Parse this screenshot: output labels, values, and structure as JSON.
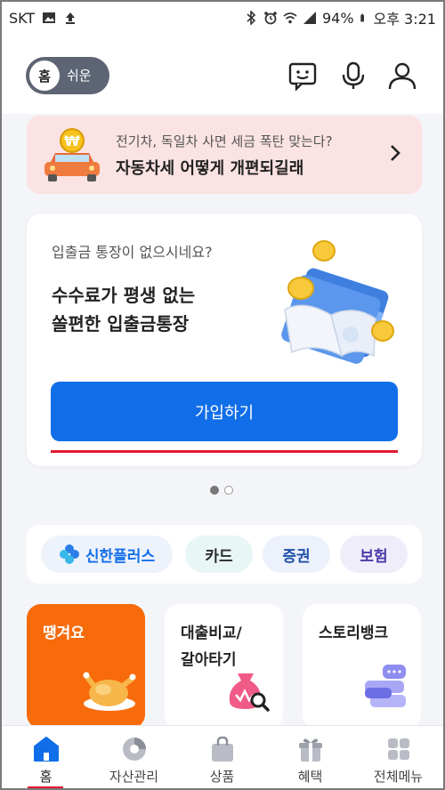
{
  "status_bar": {
    "carrier": "SKT",
    "battery": "94%",
    "time": "오후 3:21",
    "icons": [
      "photo-icon",
      "upload-icon",
      "bluetooth-icon",
      "alarm-icon",
      "wifi-icon",
      "signal-icon",
      "battery-icon"
    ]
  },
  "header": {
    "toggle_home": "홈",
    "toggle_easy": "쉬운",
    "icons": [
      "chatbot-icon",
      "microphone-icon",
      "profile-icon"
    ]
  },
  "banner": {
    "subtitle": "전기차, 독일차 사면 세금 폭탄 맞는다?",
    "title": "자동차세 어떻게 개편되길래",
    "icon": "car-with-coin-icon"
  },
  "promo_card": {
    "subtitle": "입출금 통장이 없으시네요?",
    "title_line1": "수수료가 평생 없는",
    "title_line2": "쏠편한 입출금통장",
    "button_label": "가입하기",
    "illustration": "bankbook-with-coins-icon"
  },
  "pagination": {
    "current": 1,
    "total": 2
  },
  "quick_links": [
    {
      "label": "신한플러스",
      "icon": "clover-icon",
      "bg": "#eef3fb",
      "color": "#116ee9"
    },
    {
      "label": "카드",
      "bg": "#e8f6f5",
      "color": "#2b2b2b"
    },
    {
      "label": "증권",
      "bg": "#ecf1fb",
      "color": "#1f4fa8"
    },
    {
      "label": "보험",
      "bg": "#efedf9",
      "color": "#4a3aa8"
    }
  ],
  "tiles": [
    {
      "label": "땡겨요",
      "icon": "roast-chicken-icon",
      "bg": "#f76b0b",
      "color": "#ffffff"
    },
    {
      "label_line1": "대출비교/",
      "label_line2": "갈아타기",
      "icon": "money-bag-search-icon",
      "bg": "#ffffff",
      "color": "#222222"
    },
    {
      "label": "스토리뱅크",
      "icon": "chat-bubbles-icon",
      "bg": "#ffffff",
      "color": "#222222"
    }
  ],
  "bottom_nav": [
    {
      "label": "홈",
      "icon": "home-icon",
      "active": true
    },
    {
      "label": "자산관리",
      "icon": "pie-chart-icon",
      "active": false
    },
    {
      "label": "상품",
      "icon": "shopping-bag-icon",
      "active": false
    },
    {
      "label": "혜택",
      "icon": "gift-icon",
      "active": false
    },
    {
      "label": "전체메뉴",
      "icon": "grid-menu-icon",
      "active": false
    }
  ],
  "colors": {
    "accent": "#116ee9",
    "underline": "#e3182f",
    "banner_bg": "#fbe3e3",
    "ddangyo": "#f76b0b"
  }
}
